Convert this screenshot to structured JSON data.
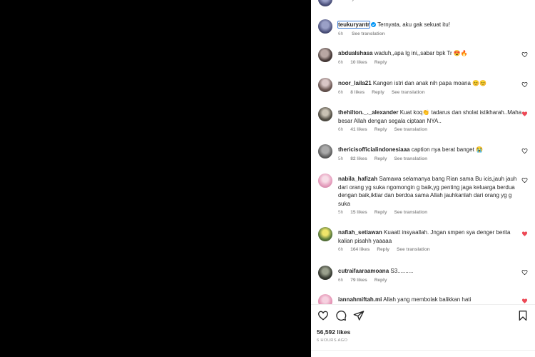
{
  "post": {
    "header_username": "teukuryantr",
    "caption_username": "teukuryantr",
    "caption_text": "Ternyata, aku gak sekuat itu!",
    "caption_time": "6h",
    "caption_translation": "See translation",
    "likes_text": "56,592 likes",
    "posted_ago": "6 HOURS AGO"
  },
  "comments": [
    {
      "username": "abdualshasa",
      "text": "waduh,,apa lg ini,,sabar bpk Tr 😍🔥",
      "time": "6h",
      "likes": "10 likes",
      "reply": "Reply",
      "translation": "",
      "liked": false
    },
    {
      "username": "noor_laila21",
      "text": "Kangen istri dan anak nih papa moana 😊😊",
      "time": "6h",
      "likes": "8 likes",
      "reply": "Reply",
      "translation": "See translation",
      "liked": false
    },
    {
      "username": "thehilton._._alexander",
      "text": "Kuat koq👏 tadarus dan sholat istikharah..Maha besar Allah dengan segala ciptaan NYA..",
      "time": "6h",
      "likes": "41 likes",
      "reply": "Reply",
      "translation": "See translation",
      "liked": true
    },
    {
      "username": "thericisofficialindonesiaaa",
      "text": "caption nya berat banget 😭",
      "time": "5h",
      "likes": "82 likes",
      "reply": "Reply",
      "translation": "See translation",
      "liked": false
    },
    {
      "username": "nabila_hafizah",
      "text": "Samawa selamanya bang Rian sama Bu icis,jauh jauh dari orang yg suka ngomongin g baik,yg penting jaga keluarga berdua dengan baik,iktiar dan berdoa sama Allah jauhkanlah dari orang yg g suka",
      "time": "5h",
      "likes": "15 likes",
      "reply": "Reply",
      "translation": "See translation",
      "liked": false
    },
    {
      "username": "nafiah_setiawan",
      "text": "Kuaatt insyaallah. Jngan smpen sya denger berita kalian pisahh yaaaaa",
      "time": "6h",
      "likes": "164 likes",
      "reply": "Reply",
      "translation": "See translation",
      "liked": true
    },
    {
      "username": "cutraifaaraamoana",
      "text": "S3..........",
      "time": "6h",
      "likes": "79 likes",
      "reply": "Reply",
      "translation": "",
      "liked": false
    },
    {
      "username": "iannahmiftah.mi",
      "text": "Allah yang membolak balikkan hati",
      "time": "",
      "likes": "",
      "reply": "",
      "translation": "",
      "liked": true
    }
  ],
  "icons": {
    "heart": "heart-icon",
    "comment": "comment-icon",
    "share": "share-icon",
    "save": "bookmark-icon",
    "verified": "verified-badge-icon"
  },
  "colors": {
    "liked_heart": "#ed4956",
    "focus_ring": "#3d7fd8",
    "verified": "#0095f6",
    "muted_text": "#8e8e8e"
  }
}
